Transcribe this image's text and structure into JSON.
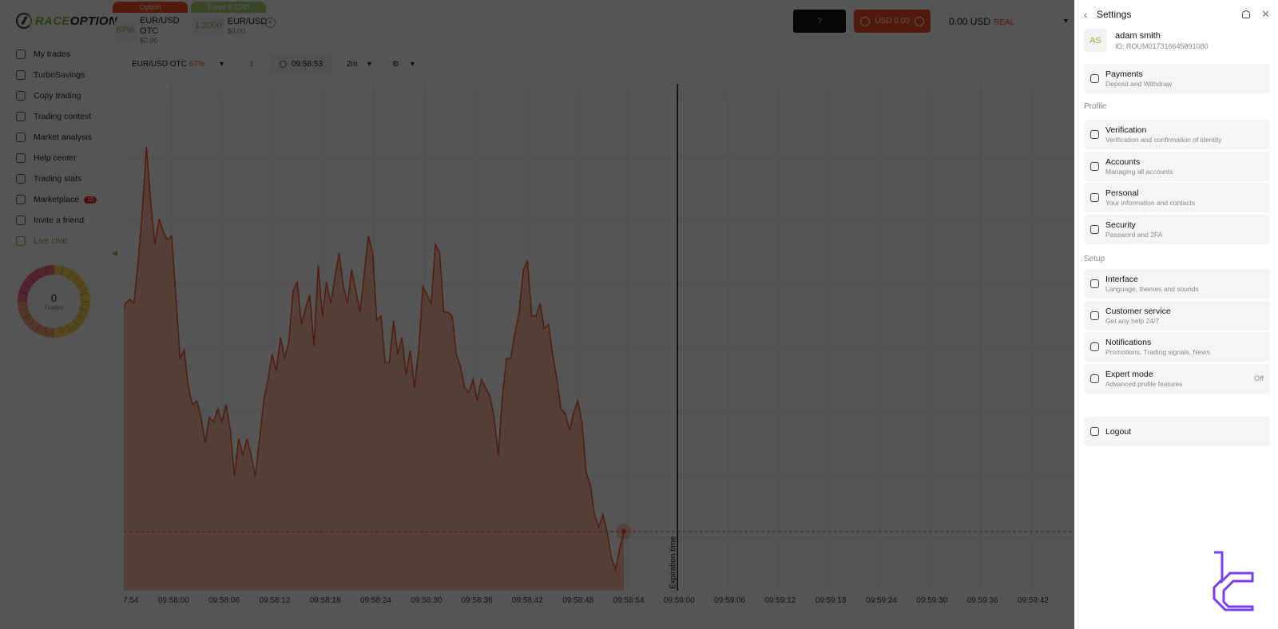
{
  "brand": {
    "race": "RACE",
    "option": "OPTION",
    "accent": "#86b43a",
    "orange": "#f04c27"
  },
  "asset_tabs": [
    {
      "head": "Option",
      "head_color": "#f04c27",
      "pct": "67%",
      "pair": "EUR/USD OTC",
      "price": "$0.00"
    },
    {
      "head": "Forex & CFD",
      "head_color": "#a8d07a",
      "pct": "1:2000",
      "pair": "EUR/USD",
      "price": "$0.00"
    }
  ],
  "header": {
    "add_symbol": "+",
    "gift_label": "?",
    "bonus_label": "USD 0.00",
    "balance": "0.00 USD",
    "account_type": "REAL"
  },
  "sidebar": {
    "items": [
      {
        "label": "My trades",
        "icon": "trades-icon"
      },
      {
        "label": "TurboSavings",
        "icon": "savings-icon"
      },
      {
        "label": "Copy trading",
        "icon": "copy-icon"
      },
      {
        "label": "Trading contest",
        "icon": "contest-icon"
      },
      {
        "label": "Market analysis",
        "icon": "analysis-icon"
      },
      {
        "label": "Help center",
        "icon": "help-icon"
      },
      {
        "label": "Trading stats",
        "icon": "stats-icon"
      },
      {
        "label": "Marketplace",
        "icon": "marketplace-icon",
        "badge": "10"
      },
      {
        "label": "Invite a friend",
        "icon": "invite-icon"
      },
      {
        "label": "Live chat",
        "icon": "chat-icon"
      }
    ],
    "trades_count": "0",
    "trades_label": "Trades"
  },
  "toolbar": {
    "symbol": "EUR/USD OTC",
    "symbol_pct": "67%",
    "time": "09:58:53",
    "interval": "2m"
  },
  "chart_data": {
    "type": "area",
    "x_tick_labels": [
      "7:54",
      "09:58:00",
      "09:58:06",
      "09:58:12",
      "09:58:18",
      "09:58:24",
      "09:58:30",
      "09:58:36",
      "09:58:42",
      "09:58:48",
      "09:58:54",
      "09:59:00",
      "09:59:06",
      "09:59:12",
      "09:59:18",
      "09:59:24",
      "09:59:30",
      "09:59:36",
      "09:59:42"
    ],
    "expiration_label": "Expiration time",
    "expiration_time": "09:59:00",
    "current_price_marker": "09:58:54",
    "series": [
      {
        "name": "EUR/USD OTC",
        "values": [
          55,
          58,
          59,
          58,
          68,
          80,
          95,
          82,
          72,
          78,
          75,
          73,
          74,
          60,
          45,
          47,
          38,
          34,
          35,
          31,
          25,
          31,
          30,
          33,
          30,
          34,
          28,
          17,
          26,
          22,
          26,
          22,
          17,
          26,
          35,
          40,
          46,
          42,
          50,
          45,
          49,
          61,
          63,
          53,
          57,
          60,
          48,
          67,
          55,
          63,
          58,
          64,
          70,
          62,
          58,
          66,
          61,
          56,
          65,
          74,
          70,
          54,
          55,
          44,
          44,
          54,
          46,
          50,
          41,
          47,
          38,
          47,
          62,
          60,
          58,
          72,
          70,
          56,
          56,
          55,
          46,
          43,
          38,
          37,
          40,
          35,
          40,
          38,
          36,
          31,
          22,
          36,
          45,
          45,
          51,
          56,
          66,
          68,
          55,
          55,
          58,
          52,
          53,
          46,
          40,
          33,
          32,
          28,
          32,
          35,
          30,
          18,
          15,
          8,
          5,
          8,
          4,
          -2,
          -5,
          0,
          4
        ]
      }
    ],
    "grid": true
  },
  "settings": {
    "title": "Settings",
    "user": {
      "initials": "AS",
      "name": "adam smith",
      "id": "ID: ROUM017316645891080"
    },
    "payments": {
      "label": "Payments",
      "sub": "Deposit and Withdraw"
    },
    "profile_heading": "Profile",
    "profile_items": [
      {
        "label": "Verification",
        "sub": "Verification and confirmation of identity"
      },
      {
        "label": "Accounts",
        "sub": "Managing all accounts"
      },
      {
        "label": "Personal",
        "sub": "Your information and contacts"
      },
      {
        "label": "Security",
        "sub": "Password and 2FA"
      }
    ],
    "setup_heading": "Setup",
    "setup_items": [
      {
        "label": "Interface",
        "sub": "Language, themes and sounds"
      },
      {
        "label": "Customer service",
        "sub": "Get any help 24/7"
      },
      {
        "label": "Notifications",
        "sub": "Promotions, Trading signals, News"
      },
      {
        "label": "Expert mode",
        "sub": "Advanced profile features",
        "value": "Off"
      }
    ],
    "logout": "Logout"
  }
}
